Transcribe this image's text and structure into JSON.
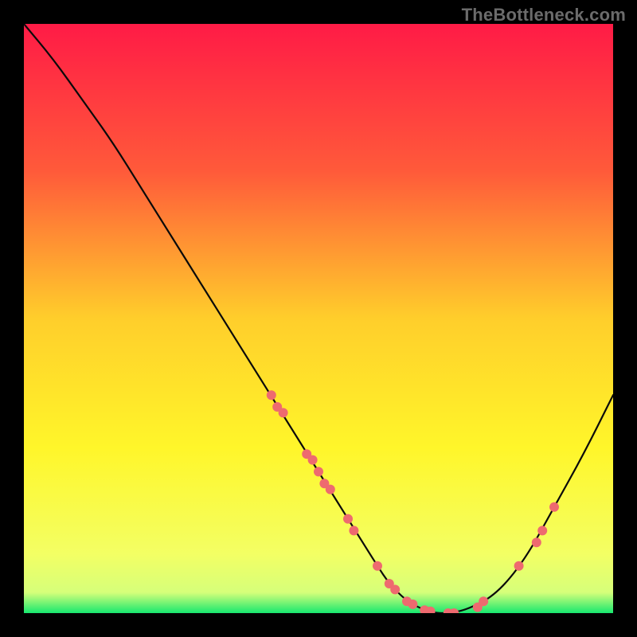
{
  "watermark": "TheBottleneck.com",
  "chart_data": {
    "type": "line",
    "title": "",
    "xlabel": "",
    "ylabel": "",
    "xlim": [
      0,
      100
    ],
    "ylim": [
      0,
      100
    ],
    "grid": false,
    "legend": false,
    "gradient_stops": [
      {
        "offset": 0.0,
        "color": "#ff1b46"
      },
      {
        "offset": 0.25,
        "color": "#ff5a3a"
      },
      {
        "offset": 0.5,
        "color": "#ffce2b"
      },
      {
        "offset": 0.72,
        "color": "#fff62a"
      },
      {
        "offset": 0.9,
        "color": "#f3ff64"
      },
      {
        "offset": 0.965,
        "color": "#d6ff7a"
      },
      {
        "offset": 1.0,
        "color": "#17e86f"
      }
    ],
    "series": [
      {
        "name": "bottleneck-curve",
        "x": [
          0,
          5,
          10,
          15,
          20,
          25,
          30,
          35,
          40,
          45,
          50,
          55,
          60,
          62,
          65,
          68,
          70,
          72,
          75,
          80,
          85,
          90,
          95,
          100
        ],
        "y": [
          100,
          94,
          87,
          80,
          72,
          64,
          56,
          48,
          40,
          32,
          24,
          16,
          8,
          5,
          2,
          0.5,
          0,
          0,
          0.5,
          3,
          9,
          18,
          27,
          37
        ]
      }
    ],
    "markers": {
      "name": "sample-points",
      "color": "#ee6a6f",
      "radius": 6,
      "points": [
        {
          "x": 42,
          "y": 37
        },
        {
          "x": 43,
          "y": 35
        },
        {
          "x": 44,
          "y": 34
        },
        {
          "x": 48,
          "y": 27
        },
        {
          "x": 49,
          "y": 26
        },
        {
          "x": 50,
          "y": 24
        },
        {
          "x": 51,
          "y": 22
        },
        {
          "x": 52,
          "y": 21
        },
        {
          "x": 55,
          "y": 16
        },
        {
          "x": 56,
          "y": 14
        },
        {
          "x": 60,
          "y": 8
        },
        {
          "x": 62,
          "y": 5
        },
        {
          "x": 63,
          "y": 4
        },
        {
          "x": 65,
          "y": 2
        },
        {
          "x": 66,
          "y": 1.5
        },
        {
          "x": 68,
          "y": 0.5
        },
        {
          "x": 69,
          "y": 0.3
        },
        {
          "x": 72,
          "y": 0
        },
        {
          "x": 73,
          "y": 0
        },
        {
          "x": 77,
          "y": 1
        },
        {
          "x": 78,
          "y": 2
        },
        {
          "x": 84,
          "y": 8
        },
        {
          "x": 87,
          "y": 12
        },
        {
          "x": 88,
          "y": 14
        },
        {
          "x": 90,
          "y": 18
        }
      ]
    }
  }
}
